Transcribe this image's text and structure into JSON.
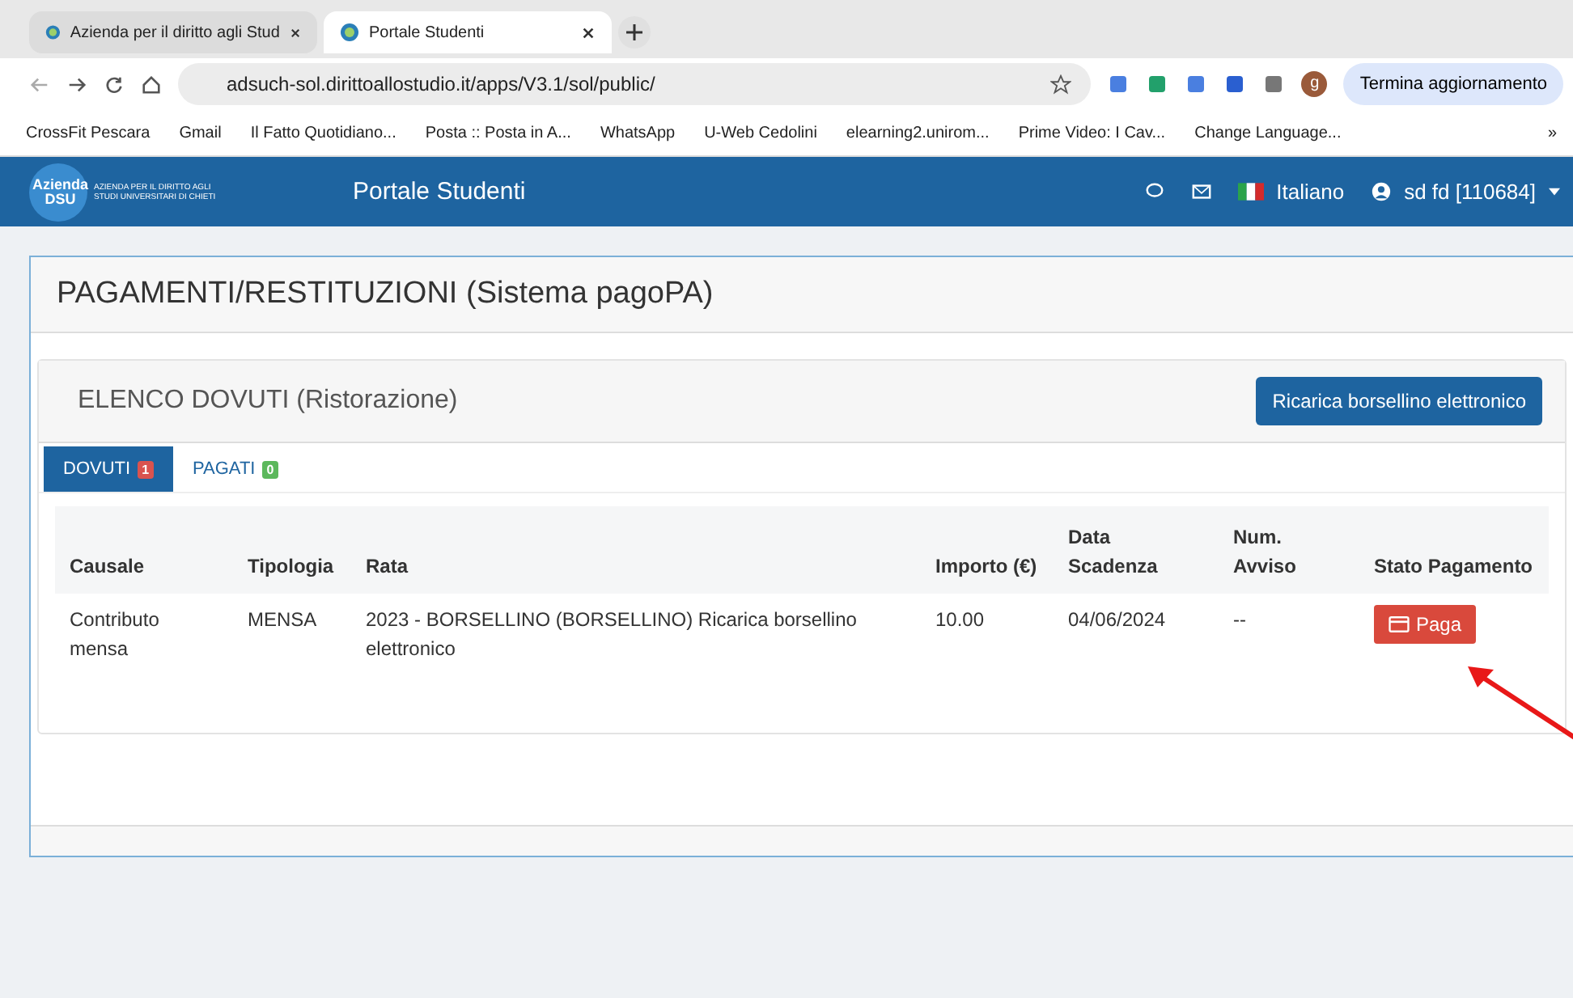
{
  "browser": {
    "tabs": [
      {
        "title": "Azienda per il diritto agli Stud",
        "selected": false
      },
      {
        "title": "Portale Studenti",
        "selected": true
      }
    ],
    "url": "adsuch-sol.dirittoallostudio.it/apps/V3.1/sol/public/",
    "profile": "g",
    "update_button": "Termina aggiornamento",
    "bookmarks": [
      "CrossFit Pescara",
      "Gmail",
      "Il Fatto Quotidiano...",
      "Posta :: Posta in A...",
      "WhatsApp",
      "U-Web Cedolini",
      "elearning2.unirom...",
      "Prime Video: I Cav...",
      "Change Language..."
    ],
    "more_bookmarks": "»"
  },
  "header": {
    "logo_text": "Azienda DSU",
    "logo_caption": "AZIENDA PER IL DIRITTO AGLI STUDI UNIVERSITARI DI CHIETI",
    "title": "Portale Studenti",
    "language": "Italiano",
    "user": "sd fd [110684]"
  },
  "panel": {
    "title": "PAGAMENTI/RESTITUZIONI (Sistema pagoPA)",
    "section": {
      "title": "ELENCO DOVUTI (Ristorazione)",
      "button": "Ricarica borsellino elettronico",
      "tabs": [
        {
          "label": "DOVUTI",
          "badge": "1",
          "color": "#d9534f",
          "selected": true
        },
        {
          "label": "PAGATI",
          "badge": "0",
          "color": "#5cb85c",
          "selected": false
        }
      ],
      "table": {
        "columns": [
          "Causale",
          "Tipologia",
          "Rata",
          "Importo (€)",
          "Data Scadenza",
          "Num. Avviso",
          "Stato Pagamento"
        ],
        "rows": [
          {
            "cells": [
              "Contributo mensa",
              "MENSA",
              "2023 - BORSELLINO (BORSELLINO) Ricarica borsellino elettronico",
              "10.00",
              "04/06/2024",
              "--"
            ],
            "action": "Paga"
          }
        ]
      }
    }
  }
}
